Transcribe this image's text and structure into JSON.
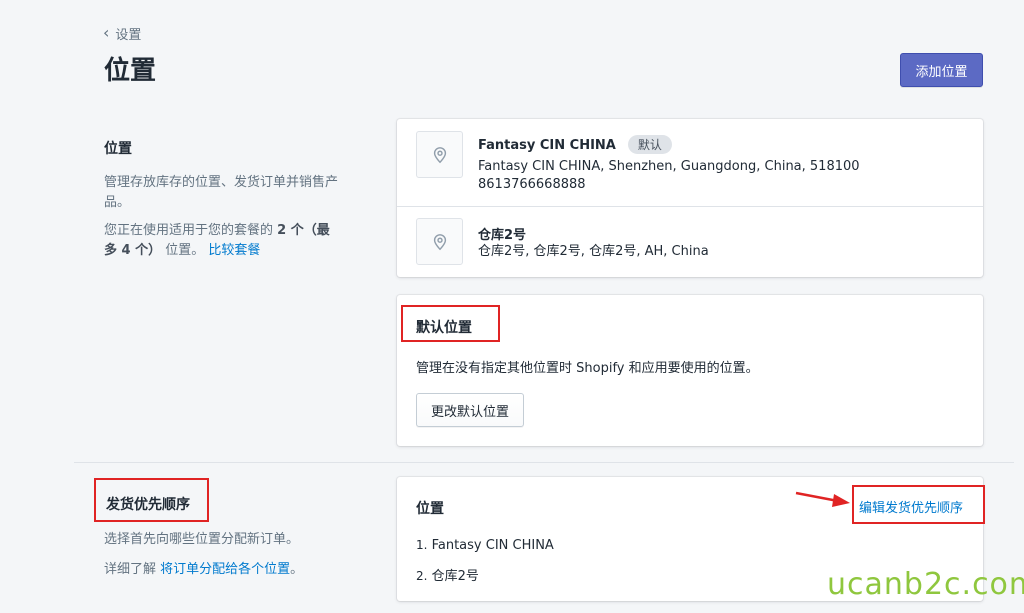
{
  "header": {
    "back_label": "设置",
    "title": "位置",
    "add_button": "添加位置"
  },
  "locations_section": {
    "title": "位置",
    "desc": "管理存放库存的位置、发货订单并销售产品。",
    "usage_prefix": "您正在使用适用于您的套餐的",
    "usage_count": "2 个（最多 4 个）",
    "usage_suffix": "位置。",
    "compare_link": "比较套餐"
  },
  "locations": [
    {
      "name": "Fantasy CIN CHINA",
      "badge": "默认",
      "address": "Fantasy CIN CHINA, Shenzhen, Guangdong, China, 518100",
      "phone": "8613766668888"
    },
    {
      "name": "仓库2号",
      "address": "仓库2号, 仓库2号, 仓库2号, AH, China"
    }
  ],
  "default_location": {
    "title": "默认位置",
    "desc": "管理在没有指定其他位置时 Shopify 和应用要使用的位置。",
    "button": "更改默认位置"
  },
  "fulfillment_section": {
    "title": "发货优先顺序",
    "desc": "选择首先向哪些位置分配新订单。",
    "learn_prefix": "详细了解",
    "learn_link": "将订单分配给各个位置",
    "learn_suffix": "。"
  },
  "fulfillment_card": {
    "title": "位置",
    "edit_link": "编辑发货优先顺序",
    "items": [
      "Fantasy CIN CHINA",
      "仓库2号"
    ]
  },
  "watermark": "ucanb2c.com",
  "colors": {
    "primary": "#5c6ac4",
    "link": "#007ace",
    "annotation": "#e02424",
    "watermark": "#8fc73e"
  }
}
